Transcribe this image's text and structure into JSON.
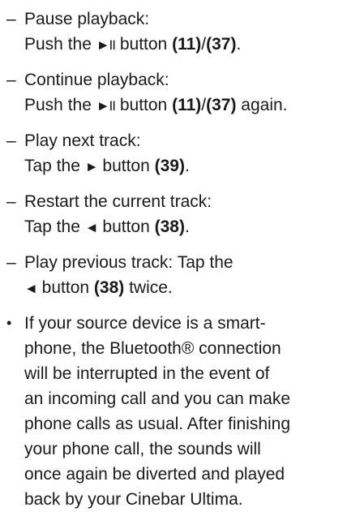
{
  "items": [
    {
      "marker": "–",
      "heading": "Pause playback:",
      "text_before": "Push the ",
      "icon": "►II",
      "text_mid": " button ",
      "ref": "(11)",
      "sep": "/",
      "ref2": "(37)",
      "text_after": "."
    },
    {
      "marker": "–",
      "heading": "Continue playback:",
      "text_before": "Push the ",
      "icon": "►II",
      "text_mid": " button ",
      "ref": "(11)",
      "sep": "/",
      "ref2": "(37)",
      "text_after": " again."
    },
    {
      "marker": "–",
      "heading": "Play next track:",
      "text_before": "Tap the ",
      "icon": "►",
      "text_mid": " button ",
      "ref": "(39)",
      "text_after": "."
    },
    {
      "marker": "–",
      "heading": "Restart the current track:",
      "text_before": "Tap the ",
      "icon": "◄",
      "text_mid": " button ",
      "ref": "(38)",
      "text_after": "."
    },
    {
      "marker": "–",
      "heading": "Play previous track: Tap the",
      "icon": "◄",
      "text_mid": " button ",
      "ref": "(38)",
      "text_after": " twice."
    }
  ],
  "note": {
    "marker": "•",
    "lines": [
      "If your source device is a smart-",
      "phone, the Bluetooth® connection",
      "will be interrupted in the event of",
      "an incoming call and you can make",
      "phone calls as usual. After finishing",
      "your phone call, the sounds will",
      "once again be diverted and played",
      "back by your Cinebar Ultima."
    ]
  }
}
